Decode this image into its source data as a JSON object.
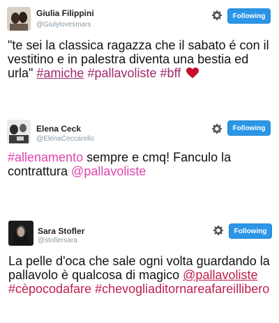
{
  "tweets": [
    {
      "name": "Giulia Filippini",
      "handle": "@Giulylovesmars",
      "follow_label": "Following",
      "text1": "\"te sei la classica ragazza che il sabato é con il vestitino e in palestra diventa una bestia ed urla\" ",
      "tags": [
        "#amiche",
        "#pallavoliste",
        "#bff"
      ]
    },
    {
      "name": "Elena Ceck",
      "handle": "@ElenaCeccarello",
      "follow_label": "Following",
      "tag_start": "#allenamento",
      "text1": " sempre e cmq! Fanculo la contrattura ",
      "mention": "@pallavoliste"
    },
    {
      "name": "Sara Stofler",
      "handle": "@stoflersara",
      "follow_label": "Following",
      "text1": "La pelle d'oca che sale ogni volta guardando la pallavolo è qualcosa di magico ",
      "mention": "@pallavoliste",
      "tag_mid": "#cèpocodafare",
      "tag_end": "#chevogliaditornareafareillibero"
    }
  ],
  "colors": {
    "follow_bg": "#2b95e6",
    "hashtag_tweet1": "#a0286a",
    "hashtag_tweet2": "#e044b0",
    "hashtag_tweet3": "#c0204d",
    "heart": "#c8102e"
  },
  "icons": [
    "gear-icon",
    "heart-icon"
  ]
}
